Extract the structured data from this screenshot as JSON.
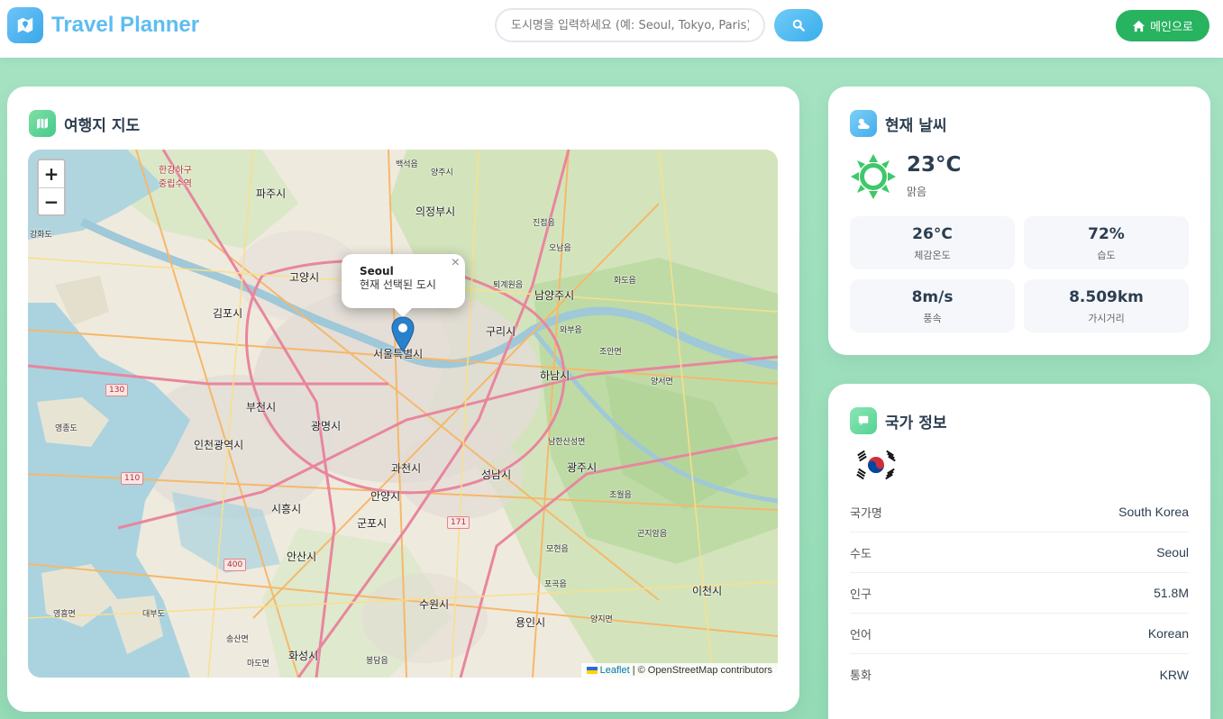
{
  "header": {
    "app_title": "Travel Planner",
    "search_placeholder": "도시명을 입력하세요 (예: Seoul, Tokyo, Paris)",
    "home_button_label": "메인으로"
  },
  "map_card": {
    "title": "여행지 지도",
    "zoom_in": "+",
    "zoom_out": "−",
    "popup": {
      "city": "Seoul",
      "text": "현재 선택된 도시",
      "close": "×"
    },
    "attribution": {
      "leaflet": "Leaflet",
      "rest": " | © OpenStreetMap contributors"
    },
    "labels": {
      "hangang": "한강하구",
      "jungnip": "중립수역",
      "paju": "파주시",
      "uijeongbu": "의정부시",
      "yangju": "양주시",
      "goyang": "고양시",
      "gimpo": "김포시",
      "namyangju": "남양주시",
      "guri": "구리시",
      "seoul": "서울특별시",
      "hanam": "하남시",
      "bucheon": "부천시",
      "gwangmyeong": "광명시",
      "incheon": "인천광역시",
      "gwacheon": "과천시",
      "seongnam": "성남시",
      "gwangju": "광주시",
      "anyang": "안양시",
      "siheung": "시흥시",
      "gunpo": "군포시",
      "ansan": "안산시",
      "suwon": "수원시",
      "yongin": "용인시",
      "hwaseong": "화성시",
      "icheon": "이천시",
      "ganghwa": "강화도",
      "yeongjong": "영종도",
      "baekseok": "백석읍",
      "toegyewon": "퇴계원읍",
      "jinjeop": "진접읍",
      "onam": "오남읍",
      "hwado": "화도읍",
      "wabu": "와부읍",
      "joan": "조안면",
      "yangseo": "양서면",
      "namhansanseong": "남한산성면",
      "chowol": "초월읍",
      "gonjiam": "곤지암읍",
      "mohyeon": "모현읍",
      "pogok": "포곡읍",
      "yangji": "양지면",
      "bongdam": "봉담읍",
      "mado": "마도면",
      "songsan": "송산면",
      "daebu": "대부도",
      "yeongheung": "영흥면"
    },
    "road_shields": [
      "130",
      "110",
      "400",
      "171"
    ]
  },
  "weather_card": {
    "title": "현재 날씨",
    "temperature": "23°C",
    "condition": "맑음",
    "stats": [
      {
        "value": "26°C",
        "label": "체감온도"
      },
      {
        "value": "72%",
        "label": "습도"
      },
      {
        "value": "8m/s",
        "label": "풍속"
      },
      {
        "value": "8.509km",
        "label": "가시거리"
      }
    ]
  },
  "country_card": {
    "title": "국가 정보",
    "rows": [
      {
        "label": "국가명",
        "value": "South Korea"
      },
      {
        "label": "수도",
        "value": "Seoul"
      },
      {
        "label": "인구",
        "value": "51.8M"
      },
      {
        "label": "언어",
        "value": "Korean"
      },
      {
        "label": "통화",
        "value": "KRW"
      }
    ]
  },
  "colors": {
    "brand": "#5dbdf0",
    "home_button": "#27b35f",
    "background": "#a6e3c3"
  },
  "icons": {
    "logo": "map-icon",
    "search": "search-icon",
    "home": "home-icon",
    "map_card": "map-icon",
    "weather_card": "cloud-sun-icon",
    "country_card": "flag-icon",
    "weather_condition": "sun-icon",
    "country_flag": "korea-flag-icon",
    "marker": "location-pin-icon"
  }
}
